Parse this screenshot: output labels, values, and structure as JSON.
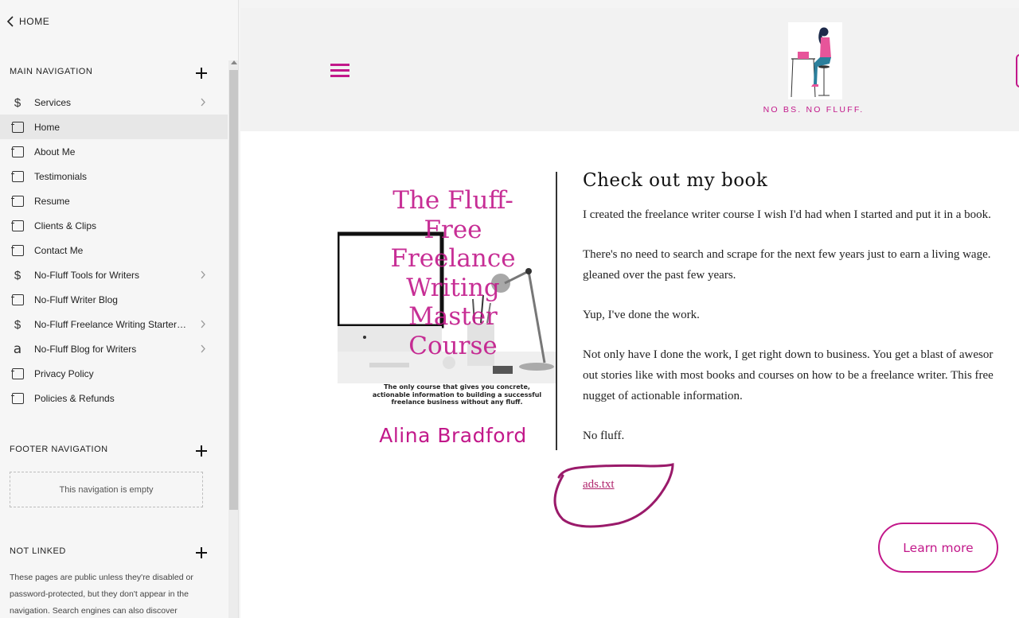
{
  "sidebar": {
    "home_label": "HOME",
    "main_nav_title": "MAIN NAVIGATION",
    "footer_nav_title": "FOOTER NAVIGATION",
    "footer_empty_text": "This navigation is empty",
    "not_linked_title": "NOT LINKED",
    "not_linked_text": "These pages are public unless they're disabled or password-protected, but they don't appear in the navigation. Search engines can also discover",
    "items": [
      {
        "label": "Services",
        "icon": "dollar-icon",
        "chevron": true
      },
      {
        "label": "Home",
        "icon": "page-icon",
        "chevron": false,
        "active": true
      },
      {
        "label": "About Me",
        "icon": "page-icon",
        "chevron": false
      },
      {
        "label": "Testimonials",
        "icon": "page-icon",
        "chevron": false
      },
      {
        "label": "Resume",
        "icon": "page-icon",
        "chevron": false
      },
      {
        "label": "Clients & Clips",
        "icon": "page-icon",
        "chevron": false
      },
      {
        "label": "Contact Me",
        "icon": "page-icon",
        "chevron": false
      },
      {
        "label": "No-Fluff Tools for Writers",
        "icon": "dollar-icon",
        "chevron": true
      },
      {
        "label": "No-Fluff Writer Blog",
        "icon": "page-icon",
        "chevron": false
      },
      {
        "label": "No-Fluff Freelance Writing Starter …",
        "icon": "dollar-icon",
        "chevron": true
      },
      {
        "label": "No-Fluff Blog for Writers",
        "icon": "blog-icon",
        "chevron": true
      },
      {
        "label": "Privacy Policy",
        "icon": "page-icon",
        "chevron": false
      },
      {
        "label": "Policies & Refunds",
        "icon": "page-icon",
        "chevron": false
      }
    ]
  },
  "site": {
    "tagline": "NO BS. NO FLUFF.",
    "accent_color": "#c2188a"
  },
  "book": {
    "title_lines": [
      "The Fluff-",
      "Free",
      "Freelance",
      "Writing",
      "Master",
      "Course"
    ],
    "subtitle_lines": [
      "The only course that gives you concrete,",
      "actionable information to building a successful",
      "freelance business without any fluff."
    ],
    "author": "Alina Bradford"
  },
  "content": {
    "heading": "Check out my book",
    "paragraphs": [
      "I created the freelance writer course I wish I'd had when I started and put it in a book.",
      "There's no need to search and scrape for the next few years just to earn a living wage.",
      "gleaned over the past few years.",
      "Yup, I've done the work.",
      "Not only have I done the work, I get right down to business. You get a blast of awesor",
      "out stories like with most books and courses on how to be a freelance writer. This free",
      "nugget of actionable information.",
      "No fluff."
    ],
    "ads_link": "ads.txt",
    "button_label": "Learn more"
  }
}
